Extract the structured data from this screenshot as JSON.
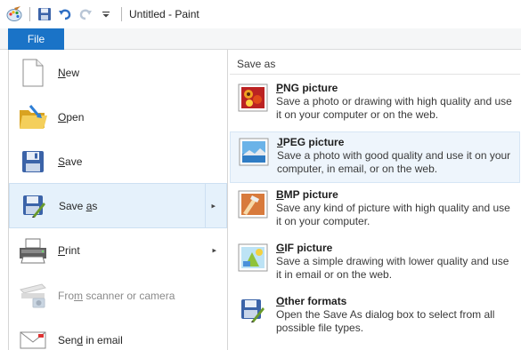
{
  "window": {
    "title": "Untitled - Paint"
  },
  "quick_access": {
    "icons": [
      "paint-app-icon",
      "save-icon",
      "undo-icon",
      "redo-icon",
      "customize-dropdown-icon"
    ]
  },
  "ribbon": {
    "file_tab": "File"
  },
  "left_menu": {
    "items": [
      {
        "pre": "",
        "u": "N",
        "post": "ew",
        "icon": "new-document-icon",
        "submenu": false,
        "disabled": false,
        "selected": false
      },
      {
        "pre": "",
        "u": "O",
        "post": "pen",
        "icon": "open-folder-icon",
        "submenu": false,
        "disabled": false,
        "selected": false
      },
      {
        "pre": "",
        "u": "S",
        "post": "ave",
        "icon": "save-icon",
        "submenu": false,
        "disabled": false,
        "selected": false
      },
      {
        "pre": "Save ",
        "u": "a",
        "post": "s",
        "icon": "save-as-icon",
        "submenu": true,
        "disabled": false,
        "selected": true
      },
      {
        "pre": "",
        "u": "P",
        "post": "rint",
        "icon": "printer-icon",
        "submenu": true,
        "disabled": false,
        "selected": false
      },
      {
        "pre": "Fro",
        "u": "m",
        "post": " scanner or camera",
        "icon": "scanner-icon",
        "submenu": false,
        "disabled": true,
        "selected": false
      },
      {
        "pre": "Sen",
        "u": "d",
        "post": " in email",
        "icon": "email-icon",
        "submenu": false,
        "disabled": false,
        "selected": false
      }
    ],
    "arrow_glyph": "▸"
  },
  "save_as_panel": {
    "header": "Save as",
    "options": [
      {
        "u": "P",
        "title_rest": "NG picture",
        "desc": "Save a photo or drawing with high quality and use it on your computer or on the web.",
        "icon": "png-picture-icon",
        "highlight": false
      },
      {
        "u": "J",
        "title_rest": "PEG picture",
        "desc": "Save a photo with good quality and use it on your computer, in email, or on the web.",
        "icon": "jpeg-picture-icon",
        "highlight": true
      },
      {
        "u": "B",
        "title_rest": "MP picture",
        "desc": "Save any kind of picture with high quality and use it on your computer.",
        "icon": "bmp-picture-icon",
        "highlight": false
      },
      {
        "u": "G",
        "title_rest": "IF picture",
        "desc": "Save a simple drawing with lower quality and use it in email or on the web.",
        "icon": "gif-picture-icon",
        "highlight": false
      },
      {
        "u": "O",
        "title_rest": "ther formats",
        "desc": "Open the Save As dialog box to select from all possible file types.",
        "icon": "other-formats-icon",
        "highlight": false
      }
    ]
  },
  "colors": {
    "file_tab": "#1a73c7",
    "selected_bg": "#e5f1fb",
    "selected_border": "#cde0f2"
  }
}
